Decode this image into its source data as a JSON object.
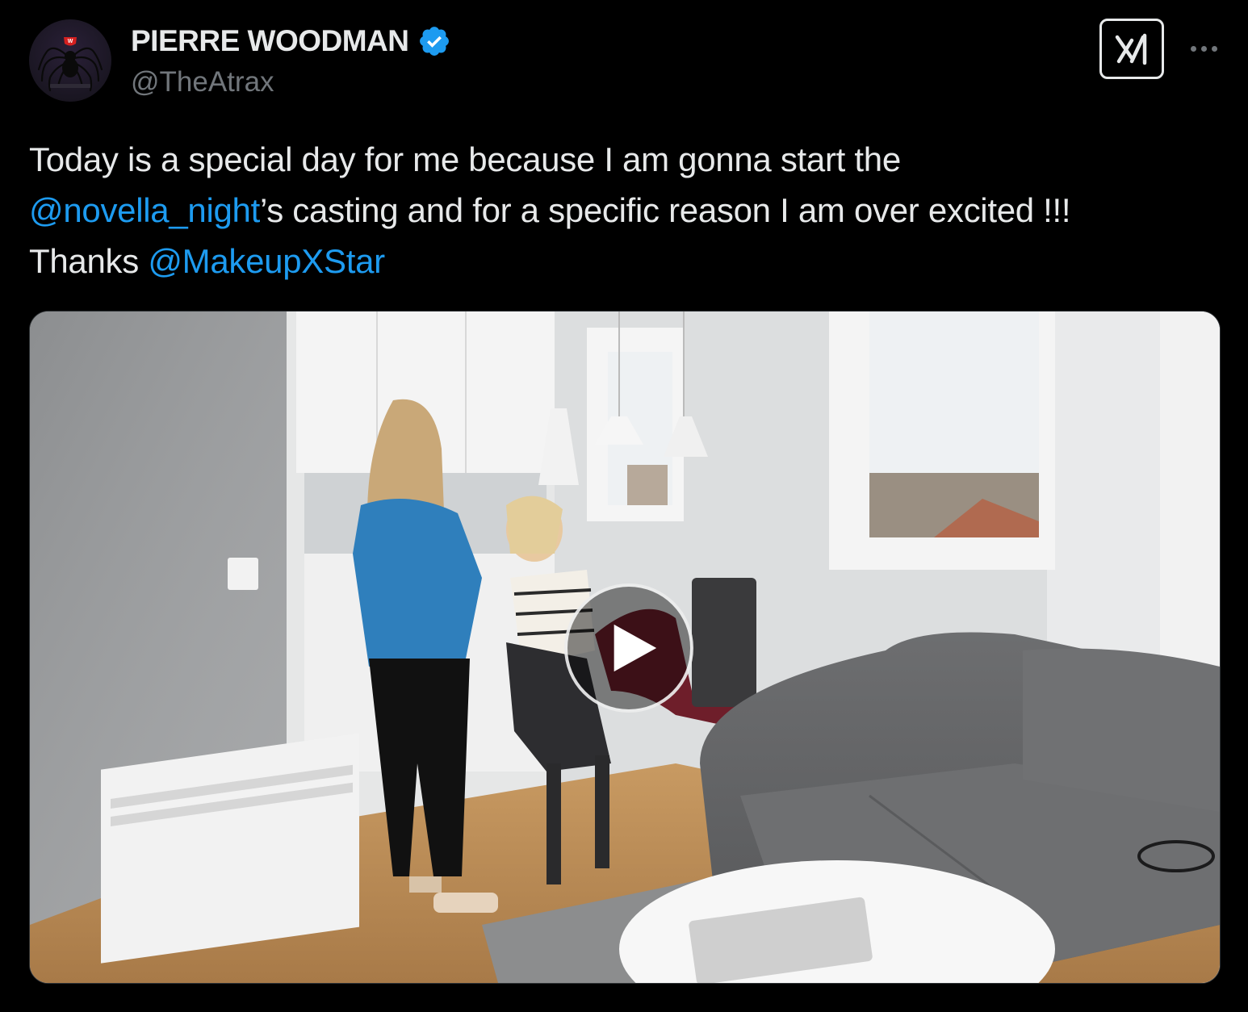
{
  "author": {
    "display_name": "PIERRE WOODMAN",
    "handle": "@TheAtrax",
    "verified": true,
    "avatar_icon": "black-widow-spider-icon"
  },
  "actions": {
    "grok_icon": "grok-logo-icon",
    "more_icon": "more-horizontal-icon"
  },
  "tweet": {
    "line1": "Today is a special day for me because I am gonna start the",
    "mention1": "@novella_night",
    "line2_rest": "’s casting and for a specific reason I am over excited !!!",
    "line3_prefix": "Thanks ",
    "mention2": "@MakeupXStar"
  },
  "media": {
    "type": "video",
    "play_icon": "play-icon"
  },
  "colors": {
    "background": "#000000",
    "text": "#e7e9ea",
    "secondary": "#71767b",
    "link": "#1d9bf0",
    "verified": "#1d9bf0"
  }
}
